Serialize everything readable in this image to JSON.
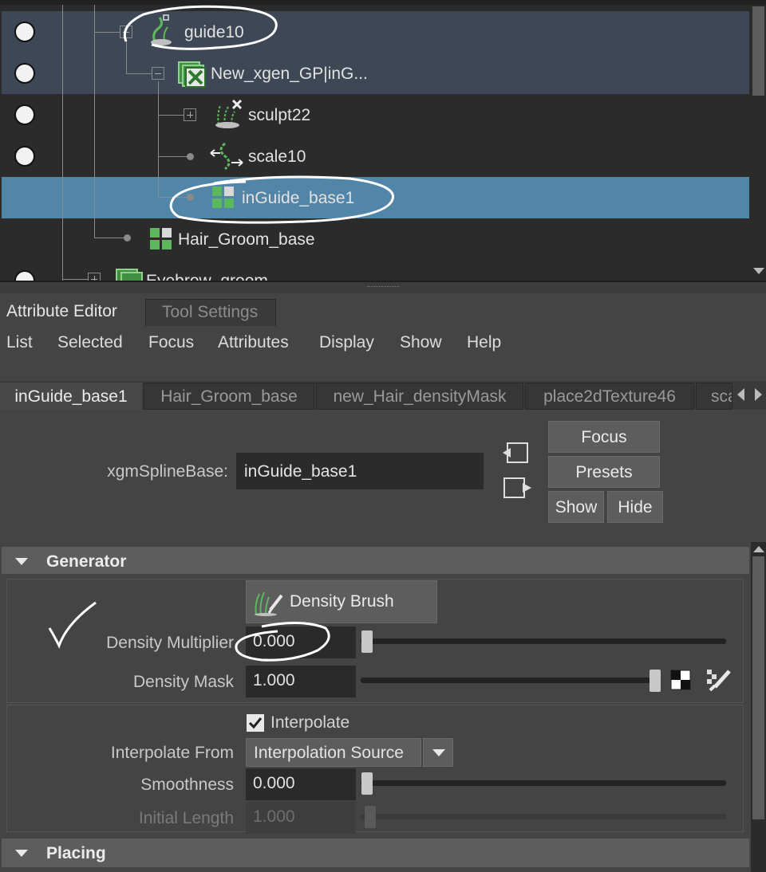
{
  "outliner": {
    "nodes": [
      {
        "label": "guide10"
      },
      {
        "label": "New_xgen_GP|inG..."
      },
      {
        "label": "sculpt22"
      },
      {
        "label": "scale10"
      },
      {
        "label": "inGuide_base1"
      },
      {
        "label": "Hair_Groom_base"
      },
      {
        "label": "Eyebrow_groom"
      }
    ]
  },
  "panel_tabs": {
    "attribute_editor": "Attribute Editor",
    "tool_settings": "Tool Settings"
  },
  "menu": [
    "List",
    "Selected",
    "Focus",
    "Attributes",
    "Display",
    "Show",
    "Help"
  ],
  "node_tabs": [
    "inGuide_base1",
    "Hair_Groom_base",
    "new_Hair_densityMask",
    "place2dTexture46",
    "sca"
  ],
  "header": {
    "type_label": "xgmSplineBase:",
    "node_name": "inGuide_base1",
    "buttons": {
      "focus": "Focus",
      "presets": "Presets",
      "show": "Show",
      "hide": "Hide"
    }
  },
  "generator": {
    "title": "Generator",
    "density_brush": "Density Brush",
    "density_multiplier": {
      "label": "Density Multiplier",
      "value": "0.000",
      "slider_fraction": 0.0
    },
    "density_mask": {
      "label": "Density Mask",
      "value": "1.000",
      "slider_fraction": 1.0
    },
    "interpolate": {
      "label": "Interpolate",
      "checked": true
    },
    "interpolate_from": {
      "label": "Interpolate From",
      "value": "Interpolation Source"
    },
    "smoothness": {
      "label": "Smoothness",
      "value": "0.000",
      "slider_fraction": 0.0
    },
    "initial_length": {
      "label": "Initial Length",
      "value": "1.000",
      "enabled": false
    }
  },
  "placing": {
    "title": "Placing"
  },
  "colors": {
    "selection_blue": "#5286a8",
    "selection_dark": "#3d4755",
    "xgen_green": "#4caf50"
  }
}
